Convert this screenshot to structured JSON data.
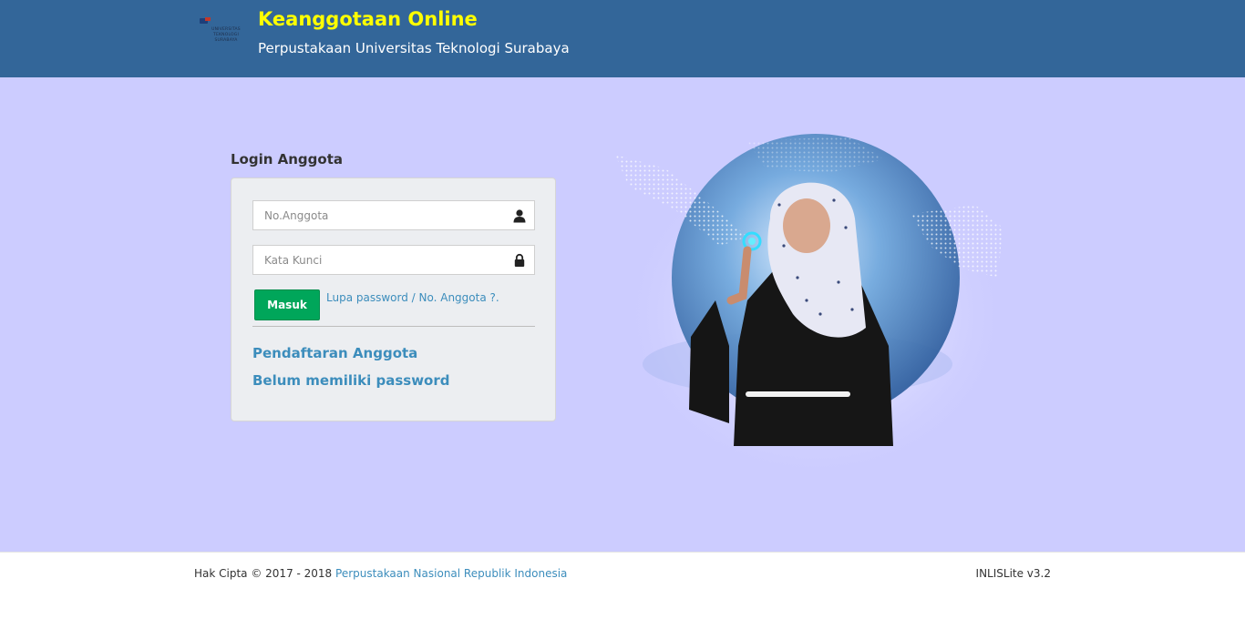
{
  "header": {
    "logo_text": "UNIVERSITAS TEKNOLOGI SURABAYA",
    "title": "Keanggotaan Online",
    "subtitle": "Perpustakaan Universitas Teknologi Surabaya"
  },
  "login": {
    "heading": "Login Anggota",
    "member_no": {
      "placeholder": "No.Anggota",
      "value": "",
      "icon": "user-icon"
    },
    "password": {
      "placeholder": "Kata Kunci",
      "value": "",
      "icon": "lock-icon"
    },
    "submit_label": "Masuk",
    "forgot_link": "Lupa password / No. Anggota ?.",
    "register_link": "Pendaftaran Anggota",
    "no_password_link": "Belum memiliki password"
  },
  "footer": {
    "copyright_prefix": "Hak Cipta © 2017 - 2018",
    "copyright_link": "Perpustakaan Nasional Republik Indonesia",
    "version": "INLISLite v3.2"
  },
  "colors": {
    "header_bg": "#336699",
    "title": "#ffff00",
    "main_bg": "#ccccff",
    "button": "#00a65a",
    "link": "#3c8dbc"
  }
}
